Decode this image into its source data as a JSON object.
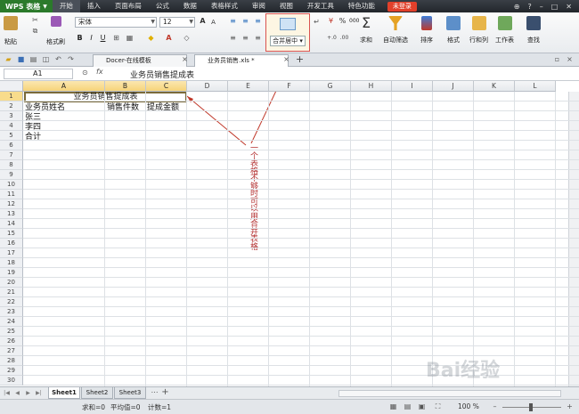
{
  "menubar": {
    "brand": "WPS 表格",
    "items": [
      "开始",
      "插入",
      "页面布局",
      "公式",
      "数据",
      "表格样式",
      "审阅",
      "视图",
      "开发工具",
      "特色功能"
    ],
    "login": "未登录"
  },
  "ribbon": {
    "paste": "粘贴",
    "format_painter": "格式刷",
    "font_name": "宋体",
    "font_size": "12",
    "bold": "B",
    "italic": "I",
    "underline": "U",
    "merge_center": "合并居中",
    "percent": "%",
    "thousands": "000",
    "sum": "求和",
    "autofilter": "自动筛选",
    "sort": "排序",
    "format": "格式",
    "rowcol": "行和列",
    "worksheet": "工作表",
    "find": "查找"
  },
  "tabs": {
    "docer": "Docer-在线模板",
    "file": "业务员销售.xls *"
  },
  "formula_bar": {
    "name_box": "A1",
    "fx": "fx",
    "content": "业务员销售提成表"
  },
  "grid": {
    "columns": [
      "A",
      "B",
      "C",
      "D",
      "E",
      "F",
      "G",
      "H",
      "I",
      "J",
      "K",
      "L"
    ],
    "rows": [
      "1",
      "2",
      "3",
      "4",
      "5",
      "6",
      "7",
      "8",
      "9",
      "10",
      "11",
      "12",
      "13",
      "14",
      "15",
      "16",
      "17",
      "18",
      "19",
      "20",
      "21",
      "22",
      "23",
      "24",
      "25",
      "26",
      "27",
      "28",
      "29",
      "30"
    ],
    "title": "业务员销售提成表",
    "header_name": "业务员姓名",
    "header_qty": "销售件数",
    "header_amount": "提成金额",
    "row3": "张三",
    "row4": "李四",
    "row5": "合计"
  },
  "annotation": "一个表格不够时可以用合并表格",
  "sheets": [
    "Sheet1",
    "Sheet2",
    "Sheet3"
  ],
  "status": {
    "sum": "求和=0",
    "avg": "平均值=0",
    "count": "计数=1",
    "zoom": "100 %"
  },
  "watermark": "Bai经验",
  "colors": {
    "accent": "#d9534f",
    "brand": "#2b7a2b",
    "selection": "#f6d47a"
  }
}
